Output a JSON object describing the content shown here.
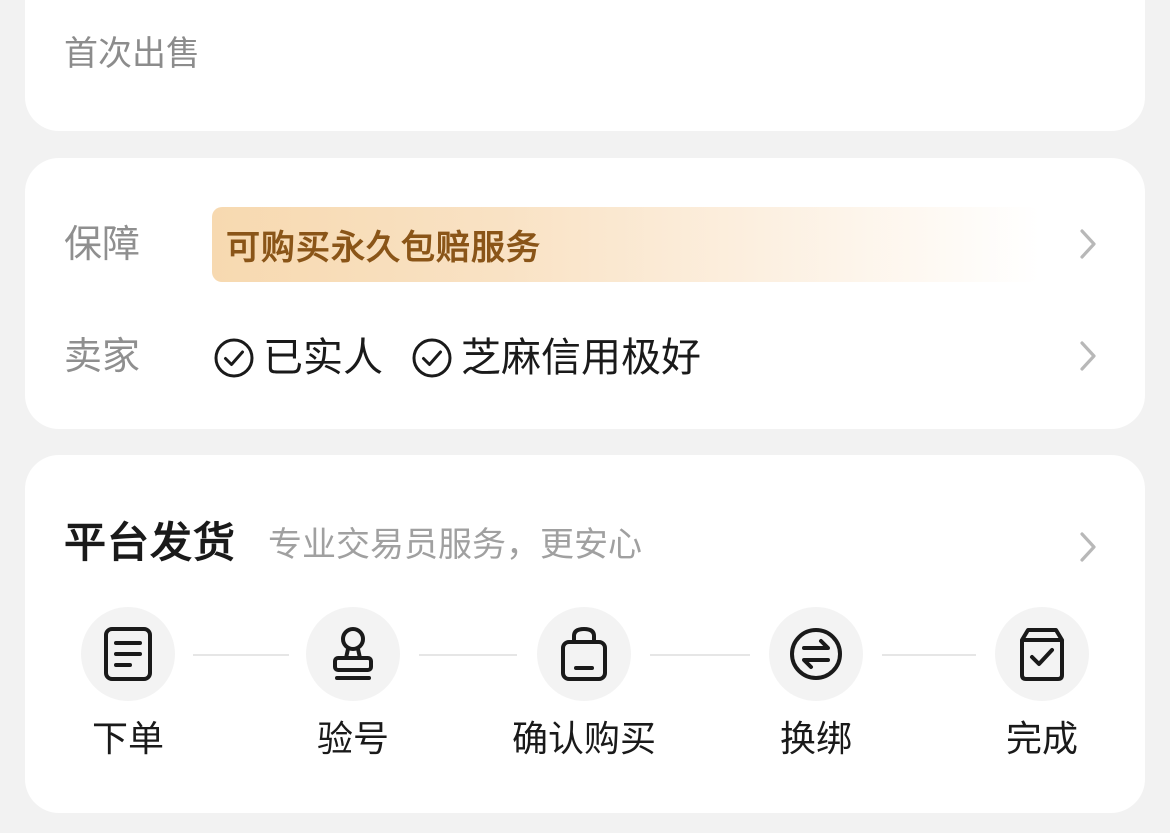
{
  "top_card": {
    "first_sale_label": "首次出售"
  },
  "guarantee_card": {
    "guarantee_label": "保障",
    "guarantee_banner_text": "可购买永久包赔服务",
    "seller_label": "卖家",
    "seller_tags": [
      {
        "text": "已实人",
        "icon": "check-circle-icon"
      },
      {
        "text": "芝麻信用极好",
        "icon": "check-circle-icon"
      }
    ]
  },
  "delivery_card": {
    "title": "平台发货",
    "subtitle": "专业交易员服务，更安心",
    "steps": [
      {
        "label": "下单",
        "icon": "document-icon"
      },
      {
        "label": "验号",
        "icon": "stamp-icon"
      },
      {
        "label": "确认购买",
        "icon": "shopping-bag-icon"
      },
      {
        "label": "换绑",
        "icon": "exchange-icon"
      },
      {
        "label": "完成",
        "icon": "checked-bag-icon"
      }
    ]
  },
  "colors": {
    "page_background": "#f2f2f2",
    "card_background": "#ffffff",
    "banner_text": "#8a5518",
    "banner_gradient_start": "#f7d9b0",
    "muted_text": "#8f8f8f"
  }
}
